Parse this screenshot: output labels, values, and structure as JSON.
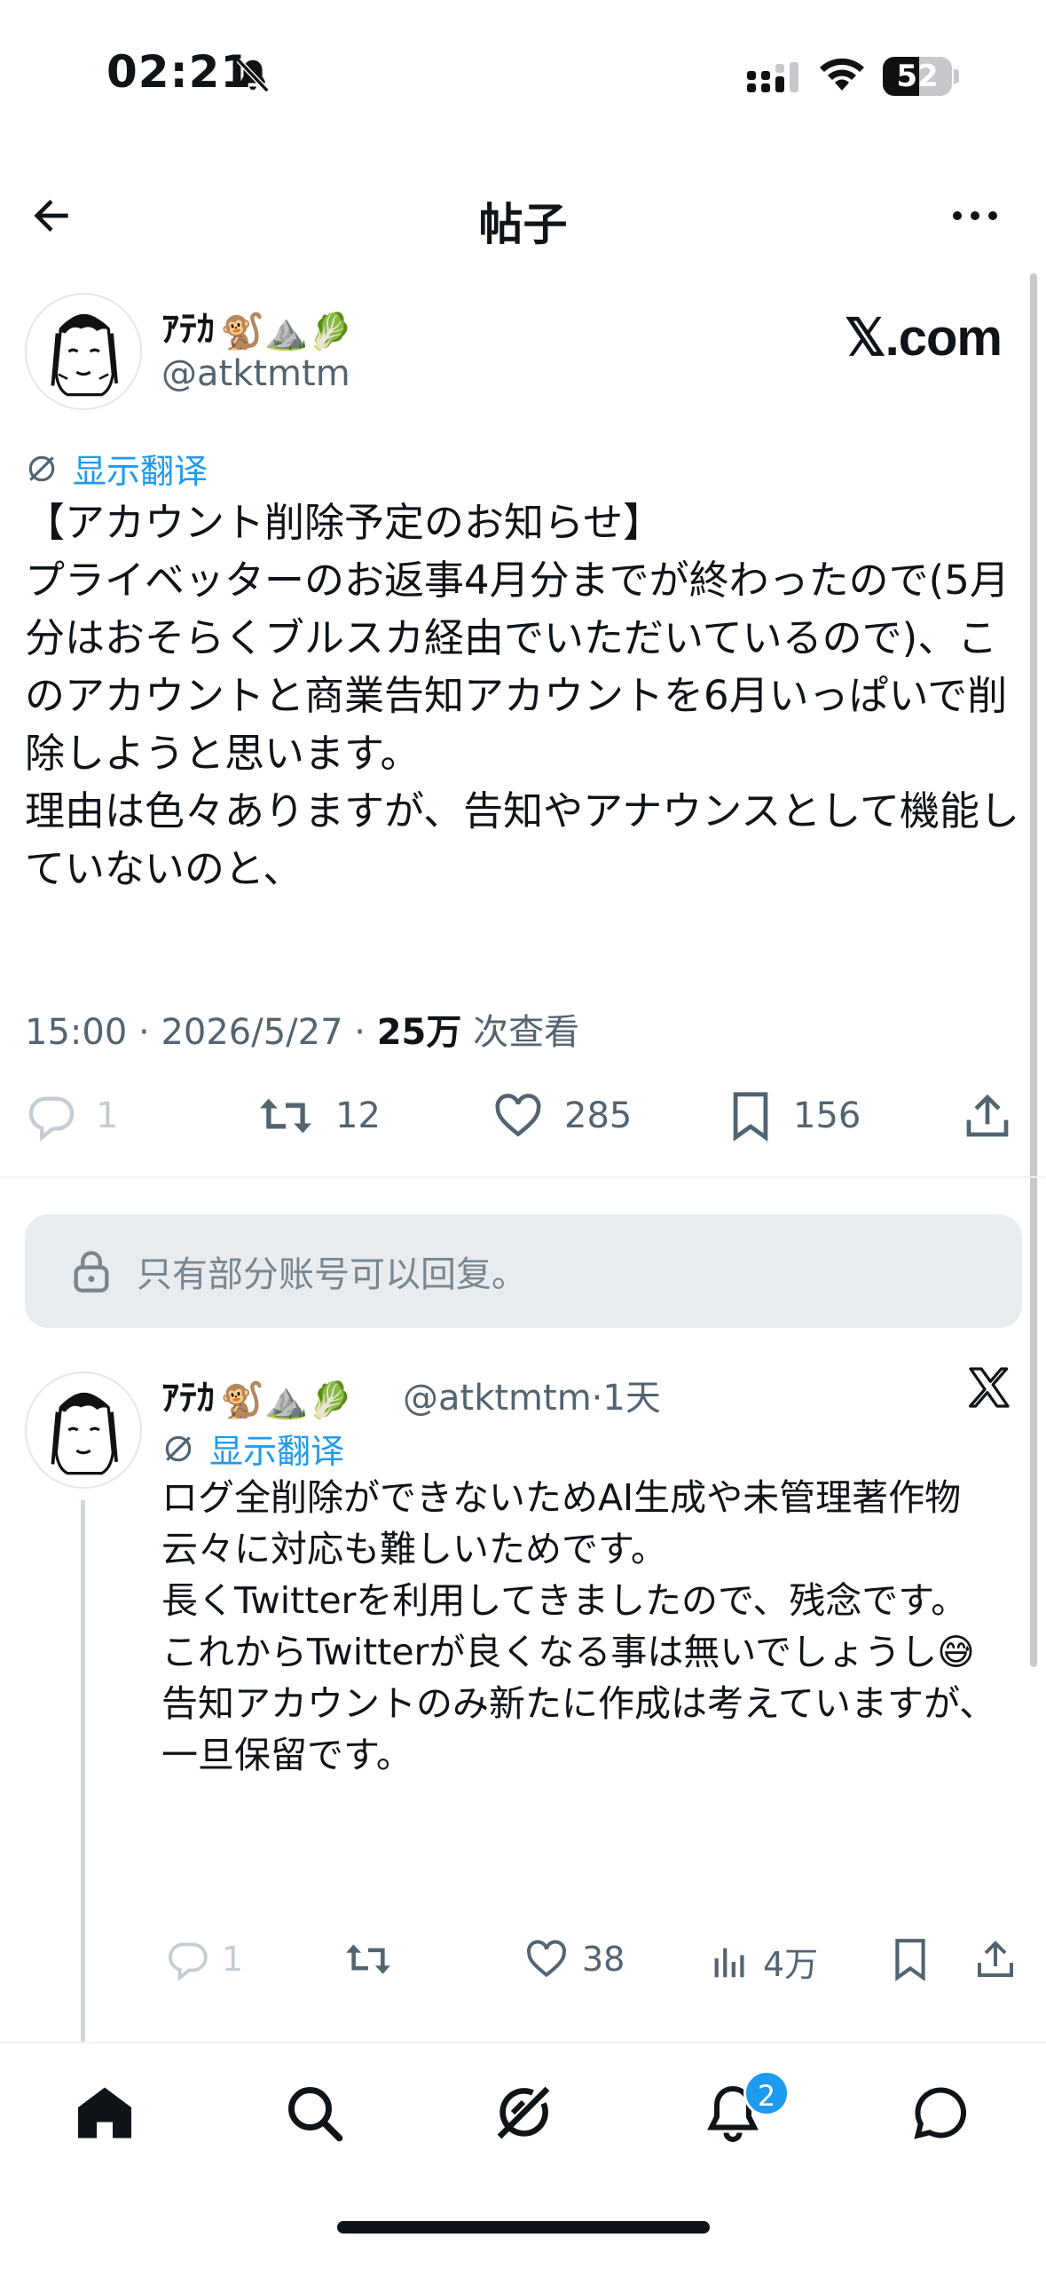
{
  "status_bar": {
    "time": "02:21",
    "battery": "52",
    "battery_level": 0.52
  },
  "header": {
    "title": "帖子"
  },
  "main_tweet": {
    "display_name": "ｱﾃｶ",
    "emojis": "🐒⛰️🥬",
    "handle": "@atktmtm",
    "source": "𝕏.com",
    "translate_label": "显示翻译",
    "text": "【アカウント削除予定のお知らせ】\nプライベッターのお返事4月分までが終わったので(5月分はおそらくブルスカ経由でいただいているので)、このアカウントと商業告知アカウントを6月いっぱいで削除しようと思います。\n理由は色々ありますが、告知やアナウンスとして機能していないのと、",
    "time": "15:00",
    "date": "2026/5/27",
    "views_count": "25万",
    "views_label": "次查看",
    "replies": "1",
    "retweets": "12",
    "likes": "285",
    "bookmarks": "156"
  },
  "reply_restriction": {
    "text": "只有部分账号可以回复。"
  },
  "reply_tweet": {
    "display_name": "ｱﾃｶ",
    "emojis": "🐒⛰️🥬",
    "handle": "@atktmtm",
    "sep": "·",
    "age": "1天",
    "translate_label": "显示翻译",
    "text": "ログ全削除ができないためAI生成や未管理著作物云々に対応も難しいためです。\n長くTwitterを利用してきましたので、残念です。\nこれからTwitterが良くなる事は無いでしょうし😅\n告知アカウントのみ新たに作成は考えていますが、一旦保留です。",
    "replies": "1",
    "likes": "38",
    "views": "4万"
  },
  "bottom_nav": {
    "notifications_badge": "2"
  },
  "icons": [
    "back-arrow-icon",
    "more-icon",
    "translate-icon",
    "reply-icon",
    "retweet-icon",
    "like-icon",
    "bookmark-icon",
    "share-icon",
    "lock-icon",
    "x-logo-icon",
    "views-icon",
    "home-icon",
    "search-icon",
    "grok-icon",
    "notifications-icon",
    "messages-icon"
  ],
  "colors": {
    "accent": "#1d9bf0",
    "text": "#0f1419",
    "muted": "#536471"
  }
}
